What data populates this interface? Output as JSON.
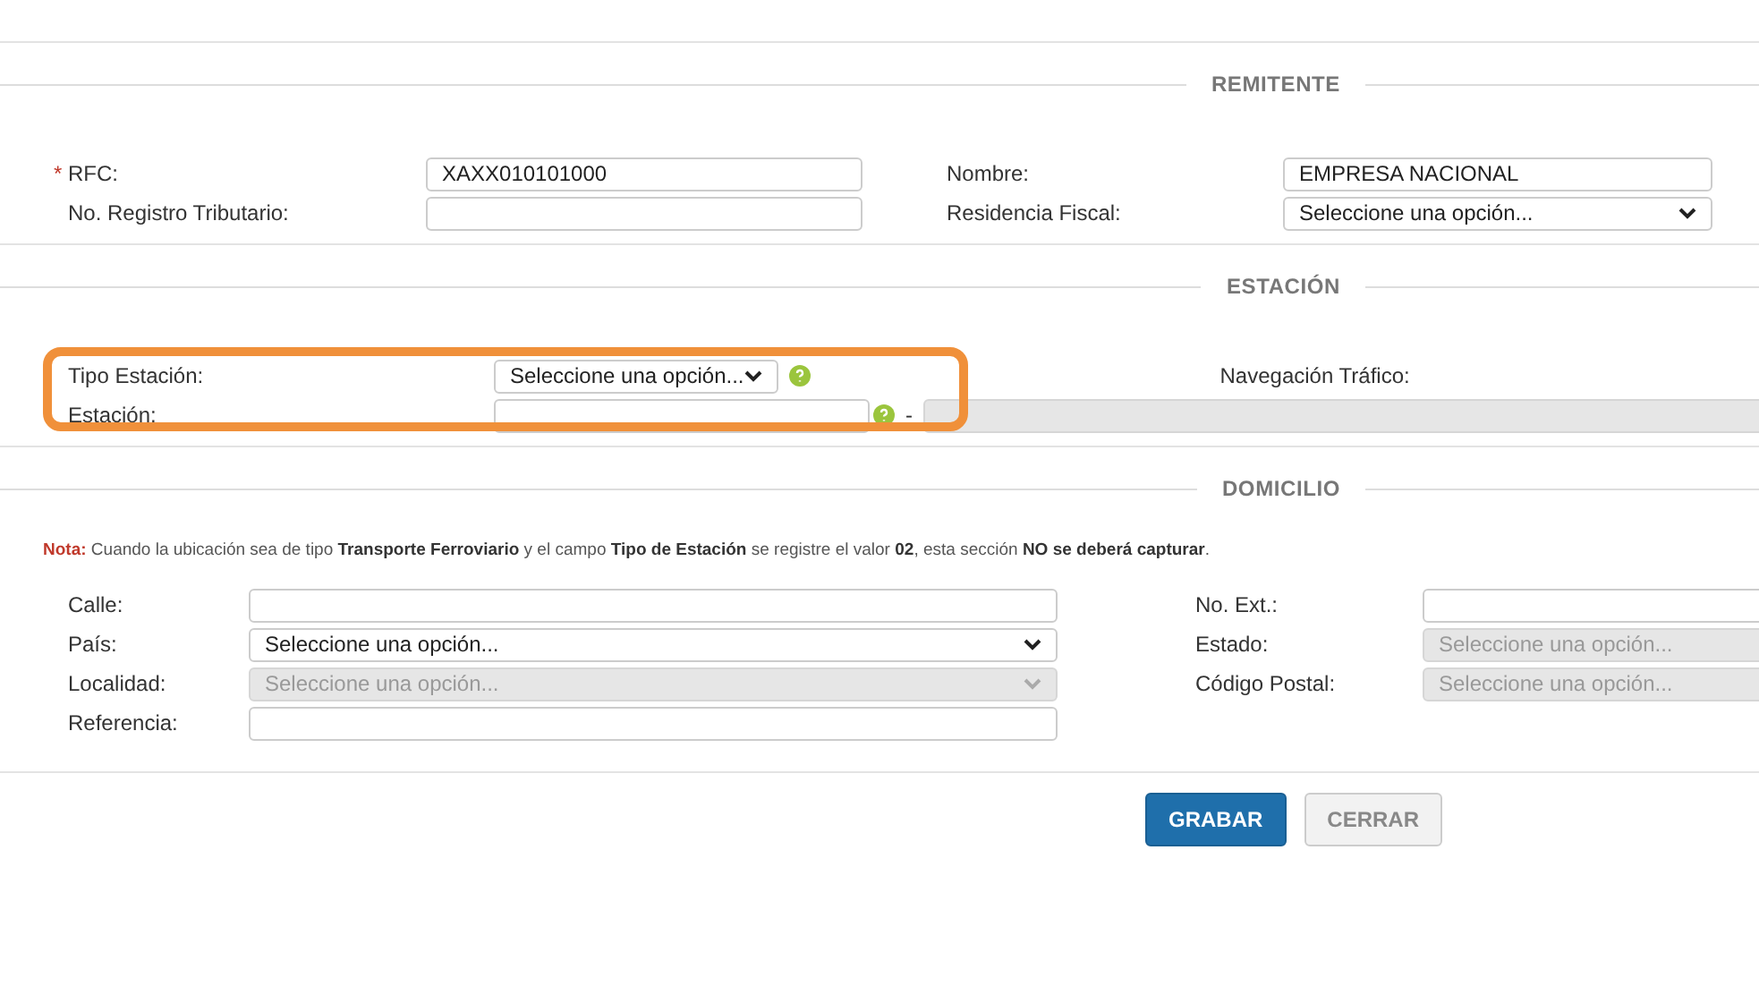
{
  "sections": [
    {
      "kind": "pairs",
      "title": "REMITENTE",
      "rows": [
        {
          "left": {
            "label": "RFC:",
            "required_mark": "*",
            "field": {
              "kind": "input",
              "value": "XAXX010101000"
            }
          },
          "right": {
            "label": "Nombre:",
            "field": {
              "kind": "input",
              "value": "EMPRESA NACIONAL"
            }
          }
        },
        {
          "left": {
            "label": "No. Registro Tributario:",
            "field": {
              "kind": "input"
            }
          },
          "right": {
            "label": "Residencia Fiscal:",
            "field": {
              "kind": "select",
              "value": "Seleccione una opción...",
              "disabled": false
            }
          }
        }
      ]
    },
    {
      "kind": "station",
      "title": "ESTACIÓN",
      "highlight": true,
      "tipo": {
        "label": "Tipo Estación:",
        "field": {
          "kind": "select",
          "value": "Seleccione una opción...",
          "disabled": false
        },
        "help": true
      },
      "navegacion_label": "Navegación Tráfico:",
      "estacion": {
        "label": "Estación:",
        "field": {
          "kind": "input"
        },
        "help": true,
        "separator": "-",
        "extra": {
          "kind": "input",
          "disabled": true
        }
      }
    },
    {
      "kind": "pairs-wide",
      "title": "DOMICILIO",
      "note": "**Nota:** Cuando la ubicación sea de tipo **Transporte Ferroviario** y el campo **Tipo de Estación** se registre el valor **02**, esta sección **NO se deberá capturar**.",
      "rows": [
        {
          "left": {
            "label": "Calle:",
            "field": {
              "kind": "input"
            }
          },
          "right": {
            "label": "No. Ext.:",
            "field": {
              "kind": "input"
            }
          }
        },
        {
          "left": {
            "label": "País:",
            "field": {
              "kind": "select",
              "value": "Seleccione una opción...",
              "disabled": false
            }
          },
          "right": {
            "label": "Estado:",
            "field": {
              "kind": "select",
              "value": "Seleccione una opción...",
              "disabled": true
            }
          }
        },
        {
          "left": {
            "label": "Localidad:",
            "field": {
              "kind": "select",
              "value": "Seleccione una opción...",
              "disabled": true
            }
          },
          "right": {
            "label": "Código Postal:",
            "field": {
              "kind": "select",
              "value": "Seleccione una opción...",
              "disabled": true
            }
          }
        },
        {
          "left": {
            "label": "Referencia:",
            "field": {
              "kind": "input"
            }
          }
        }
      ]
    }
  ],
  "buttons": [
    {
      "label": "GRABAR",
      "kind": "primary"
    },
    {
      "label": "CERRAR",
      "kind": "secondary"
    }
  ]
}
